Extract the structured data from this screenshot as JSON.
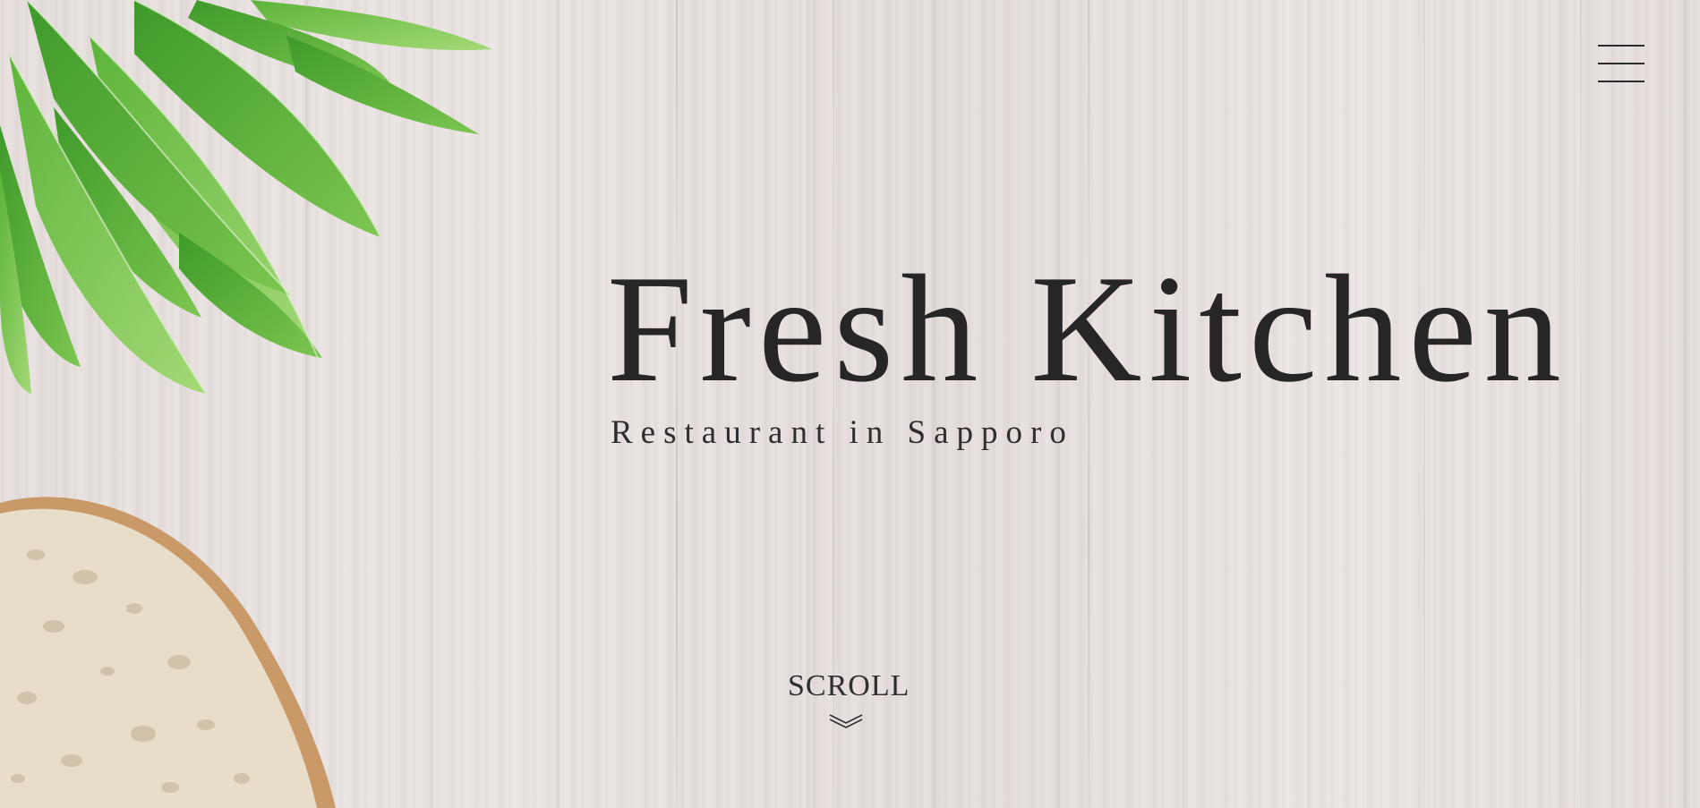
{
  "hero": {
    "title": "Fresh Kitchen",
    "subtitle": "Restaurant in Sapporo",
    "scroll_label": "SCROLL"
  },
  "header": {
    "menu_icon": "hamburger-menu-icon"
  },
  "decor": {
    "top_left_image": "green-leaves",
    "bottom_left_image": "bread-slice"
  },
  "colors": {
    "text": "#262626",
    "background": "#e9e3e1",
    "leaf": "#5fb03a",
    "bread_crust": "#c99a68"
  }
}
